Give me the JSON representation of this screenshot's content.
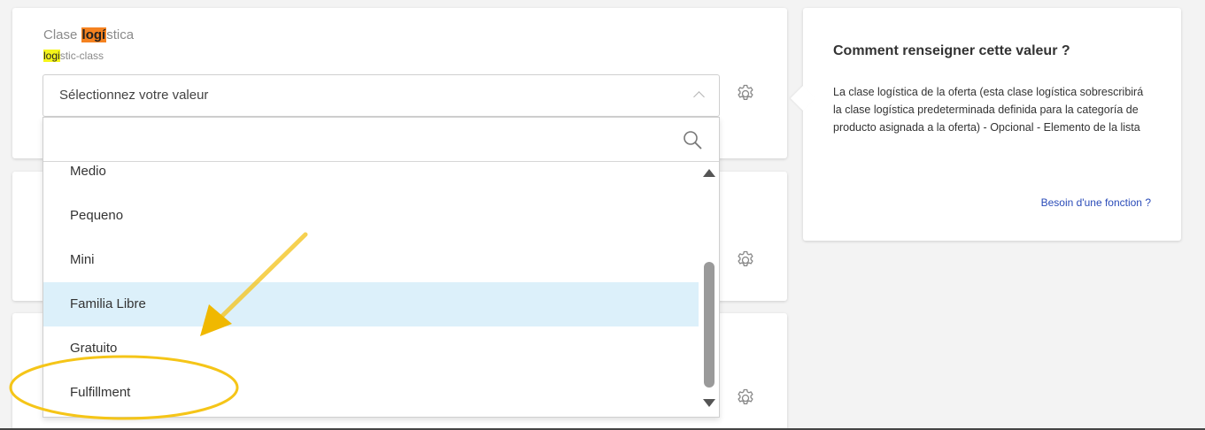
{
  "field": {
    "title_prefix": "Clase ",
    "title_highlight": "logí",
    "title_suffix": "stica",
    "sub_highlight": "logi",
    "sub_suffix": "stic-class",
    "select_placeholder": "Sélectionnez votre valeur"
  },
  "dropdown": {
    "search_placeholder": "",
    "options": [
      {
        "label": "Medio"
      },
      {
        "label": "Pequeno"
      },
      {
        "label": "Mini"
      },
      {
        "label": "Familia Libre",
        "selected": true
      },
      {
        "label": "Gratuito"
      },
      {
        "label": "Fulfillment"
      }
    ]
  },
  "help": {
    "title": "Comment renseigner cette valeur ?",
    "text": "La clase logística de la oferta (esta clase logística sobrescribirá la clase logística predeterminada definida para la categoría de producto asignada a la oferta) - Opcional - Elemento de la lista",
    "link": "Besoin d'une fonction ?"
  },
  "colors": {
    "highlight_orange": "#f58220",
    "highlight_yellow": "#f5f51a",
    "selected_option_bg": "#dcf0fa",
    "annotation_yellow": "#f5c518",
    "link_blue": "#2a4bb8"
  },
  "icons": [
    "gear-icon",
    "search-icon",
    "chevron-up-icon",
    "scroll-up-arrow-icon",
    "scroll-down-arrow-icon"
  ]
}
